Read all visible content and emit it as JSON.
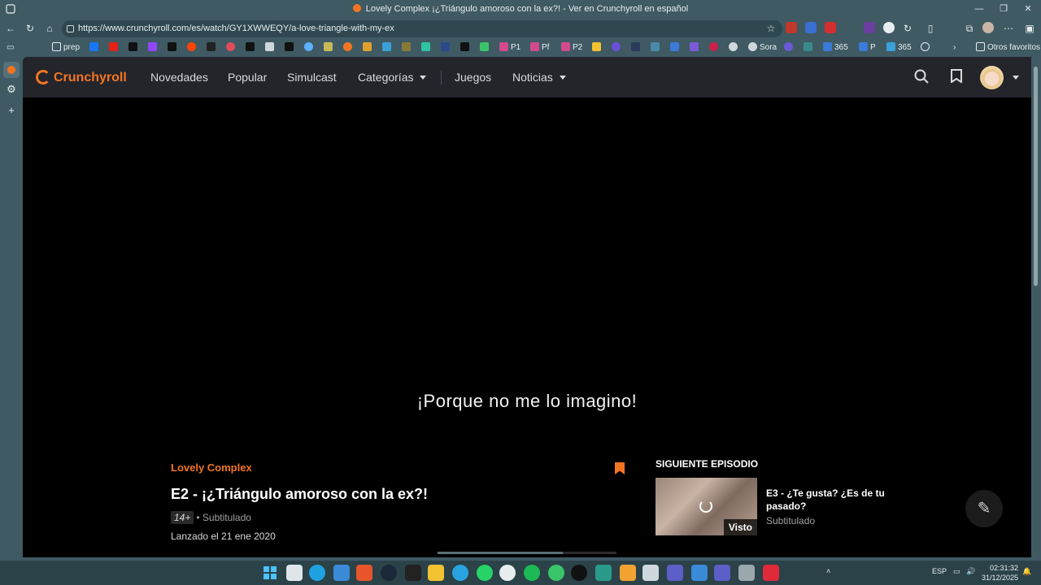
{
  "window": {
    "title": "Lovely Complex ¡¿Triángulo amoroso con la ex?! - Ver en Crunchyroll en español"
  },
  "browser": {
    "url": "https://www.crunchyroll.com/es/watch/GY1XWWEQY/a-love-triangle-with-my-ex",
    "bookmarks": [
      "prep",
      "P1",
      "Pf",
      "P2",
      "Sora",
      "365",
      "P",
      "365"
    ],
    "other_favorites": "Otros favoritos"
  },
  "site": {
    "logo": "Crunchyroll",
    "nav": [
      "Novedades",
      "Popular",
      "Simulcast",
      "Categorías",
      "Juegos",
      "Noticias"
    ],
    "accent": "#f47521"
  },
  "player": {
    "subtitle_line": "¡Porque no me lo imagino!"
  },
  "episode": {
    "series": "Lovely Complex",
    "title": "E2 - ¡¿Triángulo amoroso con la ex?!",
    "rating": "14+",
    "audio": "• Subtitulado",
    "released": "Lanzado el 21 ene 2020"
  },
  "next": {
    "label": "SIGUIENTE EPISODIO",
    "title": "E3 - ¿Te gusta? ¿Es de tu pasado?",
    "sub": "Subtitulado",
    "watched": "Visto"
  },
  "taskbar": {
    "lang": "ESP",
    "time": "02:31:32",
    "date": "31/12/2025"
  }
}
